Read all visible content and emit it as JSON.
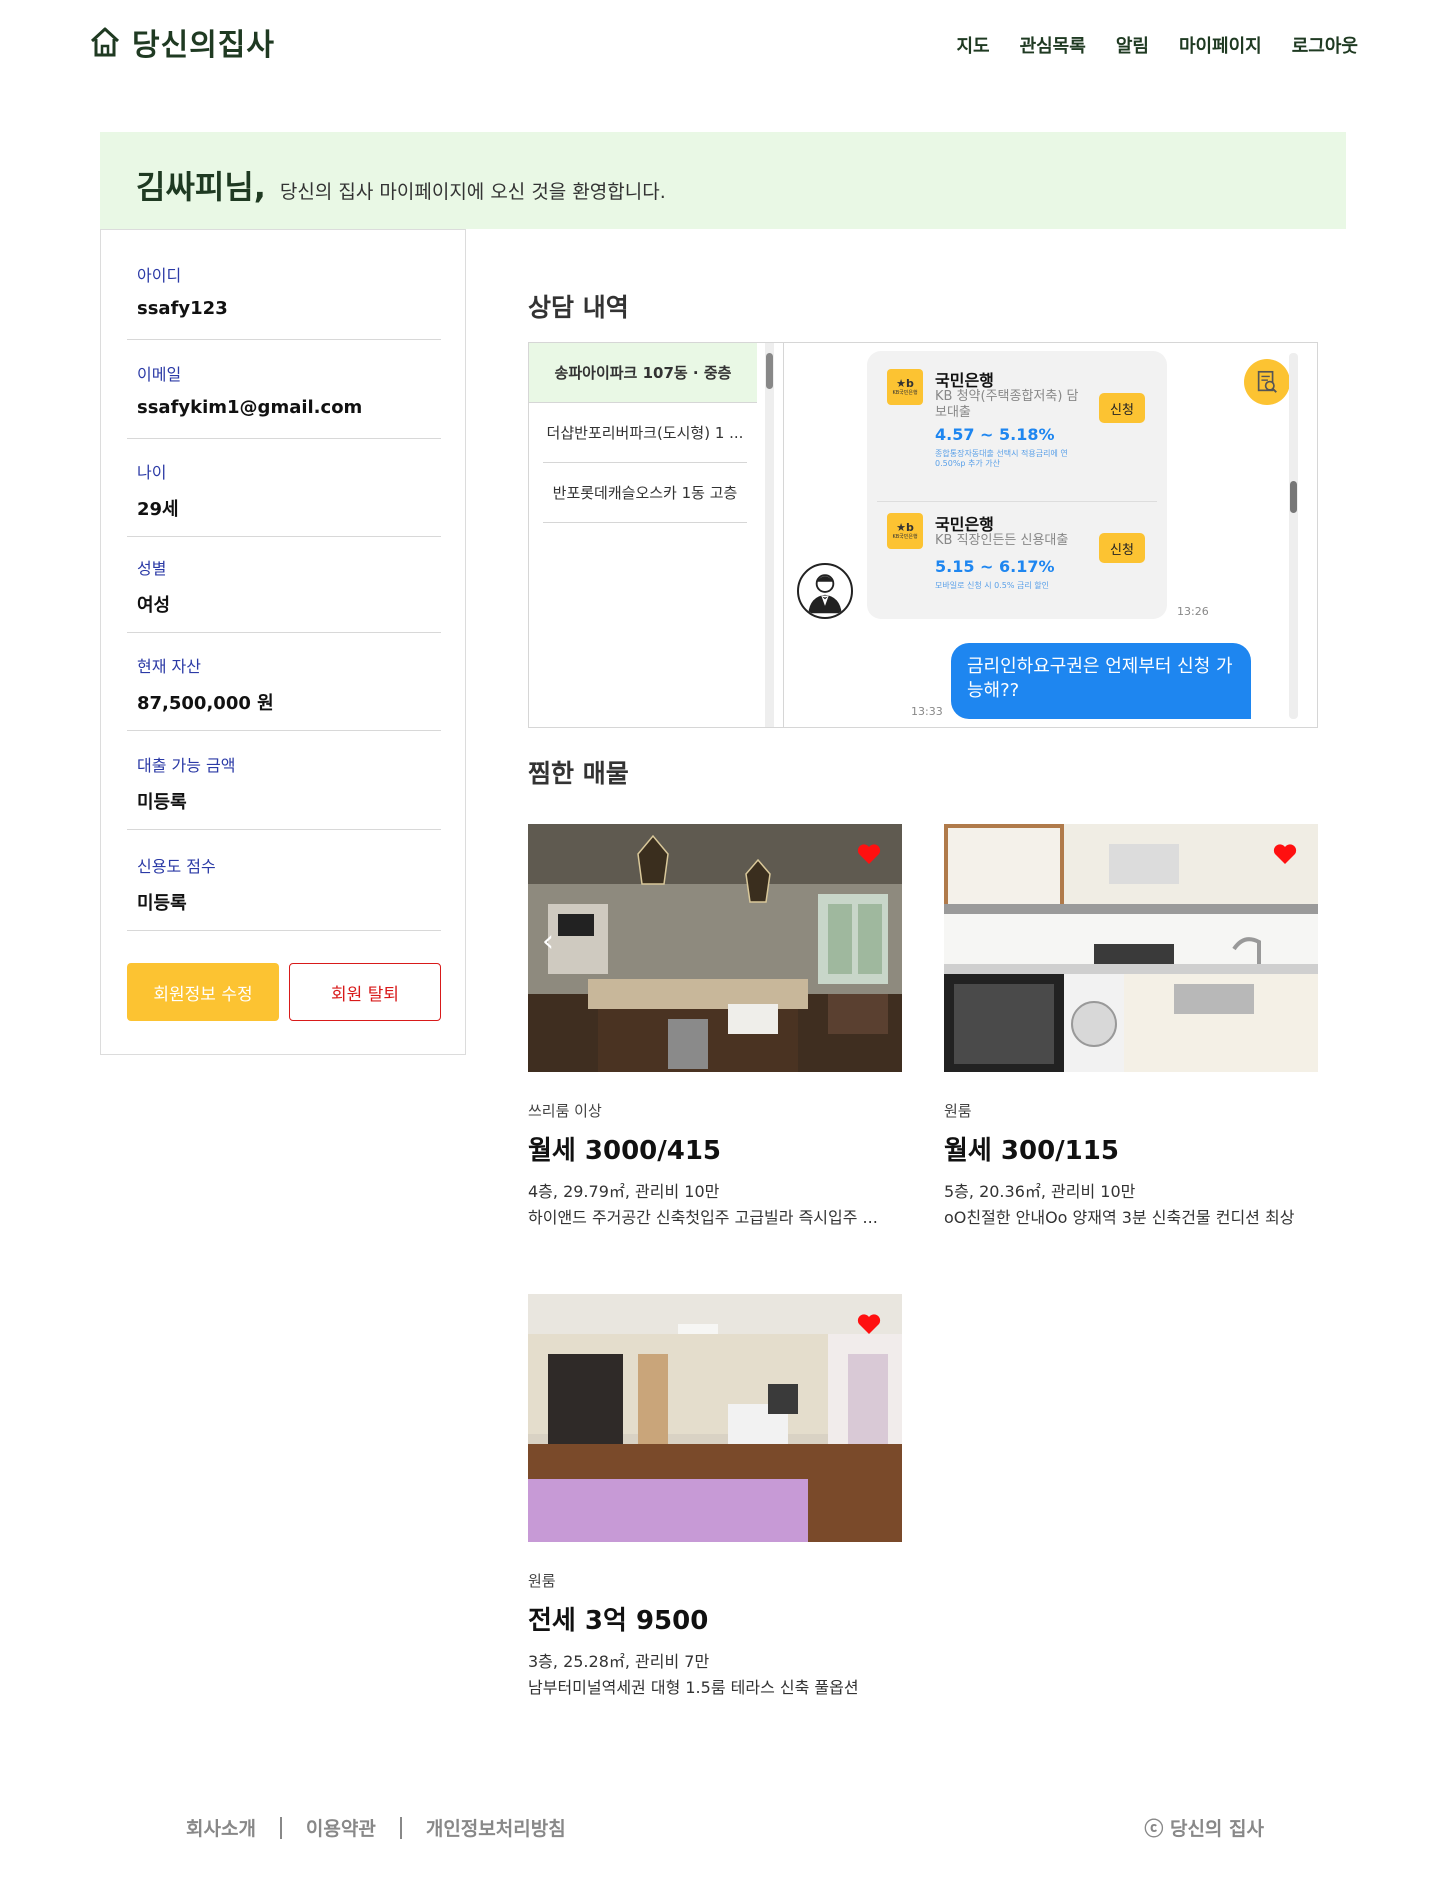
{
  "header": {
    "logo_text": "당신의집사",
    "nav": [
      "지도",
      "관심목록",
      "알림",
      "마이페이지",
      "로그아웃"
    ]
  },
  "banner": {
    "name": "김싸피님,",
    "subtitle": "당신의 집사 마이페이지에 오신 것을 환영합니다."
  },
  "profile": {
    "fields": [
      {
        "label": "아이디",
        "value": "ssafy123"
      },
      {
        "label": "이메일",
        "value": "ssafykim1@gmail.com"
      },
      {
        "label": "나이",
        "value": "29세"
      },
      {
        "label": "성별",
        "value": "여성"
      },
      {
        "label": "현재 자산",
        "value": "87,500,000 원"
      },
      {
        "label": "대출 가능 금액",
        "value": "미등록"
      },
      {
        "label": "신용도 점수",
        "value": "미등록"
      }
    ],
    "edit_button": "회원정보 수정",
    "leave_button": "회원 탈퇴"
  },
  "consult": {
    "title": "상담 내역",
    "list": [
      "송파아이파크 107동 · 중층",
      "더샵반포리버파크(도시형) 1 ...",
      "반포롯데캐슬오스카 1동 고층"
    ],
    "loans": [
      {
        "bank": "국민은행",
        "logo_mark": "★b",
        "logo_sub": "KB국민은행",
        "product": "KB 청약(주택종합저축) 담보대출",
        "rate": "4.57 ~ 5.18%",
        "note": "종합통장자동대출 선택시 적용금리에 연 0.50%p 추가 가산",
        "apply": "신청"
      },
      {
        "bank": "국민은행",
        "logo_mark": "★b",
        "logo_sub": "KB국민은행",
        "product": "KB 직장인든든 신용대출",
        "rate": "5.15 ~ 6.17%",
        "note": "모바일로 신청 시 0.5% 금리 할인",
        "apply": "신청"
      }
    ],
    "agent_time": "13:26",
    "my_message": "금리인하요구권은 언제부터 신청 가능해??",
    "my_time": "13:33"
  },
  "favorites": {
    "title": "찜한 매물",
    "items": [
      {
        "type": "쓰리룸 이상",
        "price": "월세 3000/415",
        "info": "4층, 29.79㎡, 관리비 10만",
        "desc": "하이앤드 주거공간 신축첫입주 고급빌라 즉시입주 ..."
      },
      {
        "type": "원룸",
        "price": "월세 300/115",
        "info": "5층, 20.36㎡, 관리비 10만",
        "desc": "oO친절한 안내Oo 양재역 3분 신축건물 컨디션 최상"
      },
      {
        "type": "원룸",
        "price": "전세 3억 9500",
        "info": "3층, 25.28㎡, 관리비 7만",
        "desc": "남부터미널역세권 대형 1.5룸 테라스 신축 풀옵션"
      }
    ],
    "prev_arrow": "‹"
  },
  "footer": {
    "links": [
      "회사소개",
      "이용약관",
      "개인정보처리방침"
    ],
    "copyright": "ⓒ 당신의 집사"
  },
  "colors": {
    "accent_yellow": "#fcc332",
    "banner_green": "#e9f8e5",
    "brand_dark": "#1f3a22",
    "chat_blue": "#1e86f0",
    "danger_red": "#d81a1a"
  }
}
